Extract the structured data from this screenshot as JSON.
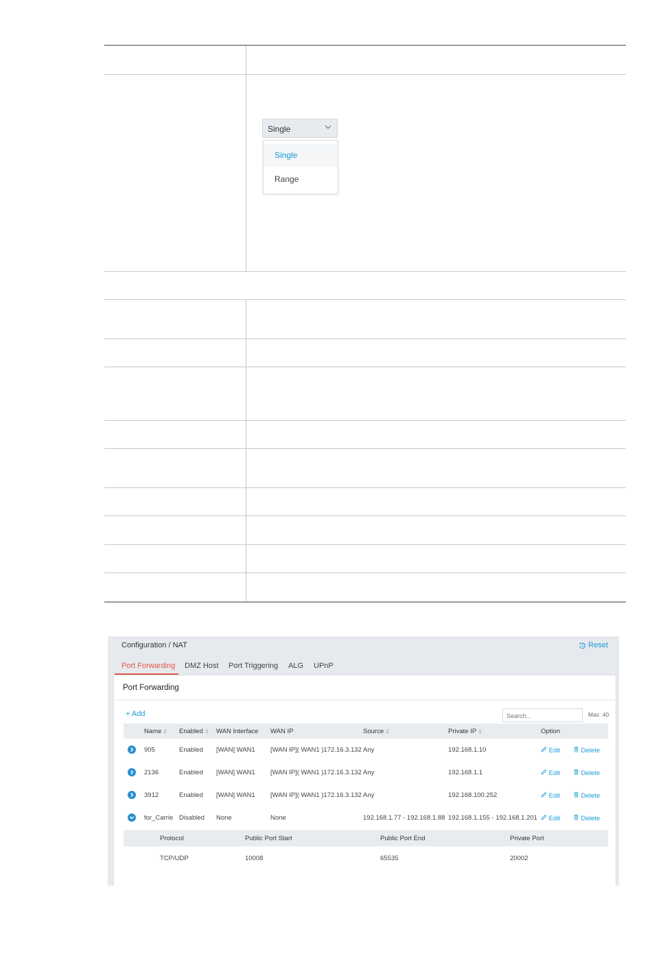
{
  "dropdown": {
    "selected": "Single",
    "options": [
      "Single",
      "Range"
    ]
  },
  "nat": {
    "breadcrumb": "Configuration / NAT",
    "reset_label": "Reset",
    "tabs": [
      "Port Forwarding",
      "DMZ Host",
      "Port Triggering",
      "ALG",
      "UPnP"
    ],
    "active_tab": "Port Forwarding",
    "panel_title": "Port Forwarding",
    "add_label": "+ Add",
    "search_placeholder": "Search...",
    "max_label": "Max: 40",
    "columns": [
      "Name",
      "Enabled",
      "WAN Interface",
      "WAN IP",
      "Source",
      "Private IP",
      "Option"
    ],
    "rows": [
      {
        "name": "905",
        "enabled": "Enabled",
        "wan_interface": "[WAN] WAN1",
        "wan_ip": "[WAN IP]( WAN1 )172.16.3.132",
        "source": "Any",
        "private_ip": "192.168.1.10",
        "edit": "Edit",
        "delete": "Delete"
      },
      {
        "name": "2136",
        "enabled": "Enabled",
        "wan_interface": "[WAN] WAN1",
        "wan_ip": "[WAN IP]( WAN1 )172.16.3.132",
        "source": "Any",
        "private_ip": "192.168.1.1",
        "edit": "Edit",
        "delete": "Delete"
      },
      {
        "name": "3912",
        "enabled": "Enabled",
        "wan_interface": "[WAN] WAN1",
        "wan_ip": "[WAN IP]( WAN1 )172.16.3.132",
        "source": "Any",
        "private_ip": "192.168.100.252",
        "edit": "Edit",
        "delete": "Delete"
      },
      {
        "name": "for_Carrie",
        "enabled": "Disabled",
        "wan_interface": "None",
        "wan_ip": "None",
        "source": "192.168.1.77 - 192.168.1.88",
        "private_ip": "192.168.1.155 - 192.168.1.201",
        "edit": "Edit",
        "delete": "Delete"
      }
    ],
    "detail": {
      "columns": [
        "Protocol",
        "Public Port Start",
        "Public Port End",
        "Private Port"
      ],
      "row": {
        "protocol": "TCP/UDP",
        "public_port_start": "10008",
        "public_port_end": "65535",
        "private_port": "20002"
      }
    },
    "colors": {
      "accent": "#1a9ad6",
      "active_tab": "#e2574c",
      "expander": "#2a8fd0"
    }
  }
}
